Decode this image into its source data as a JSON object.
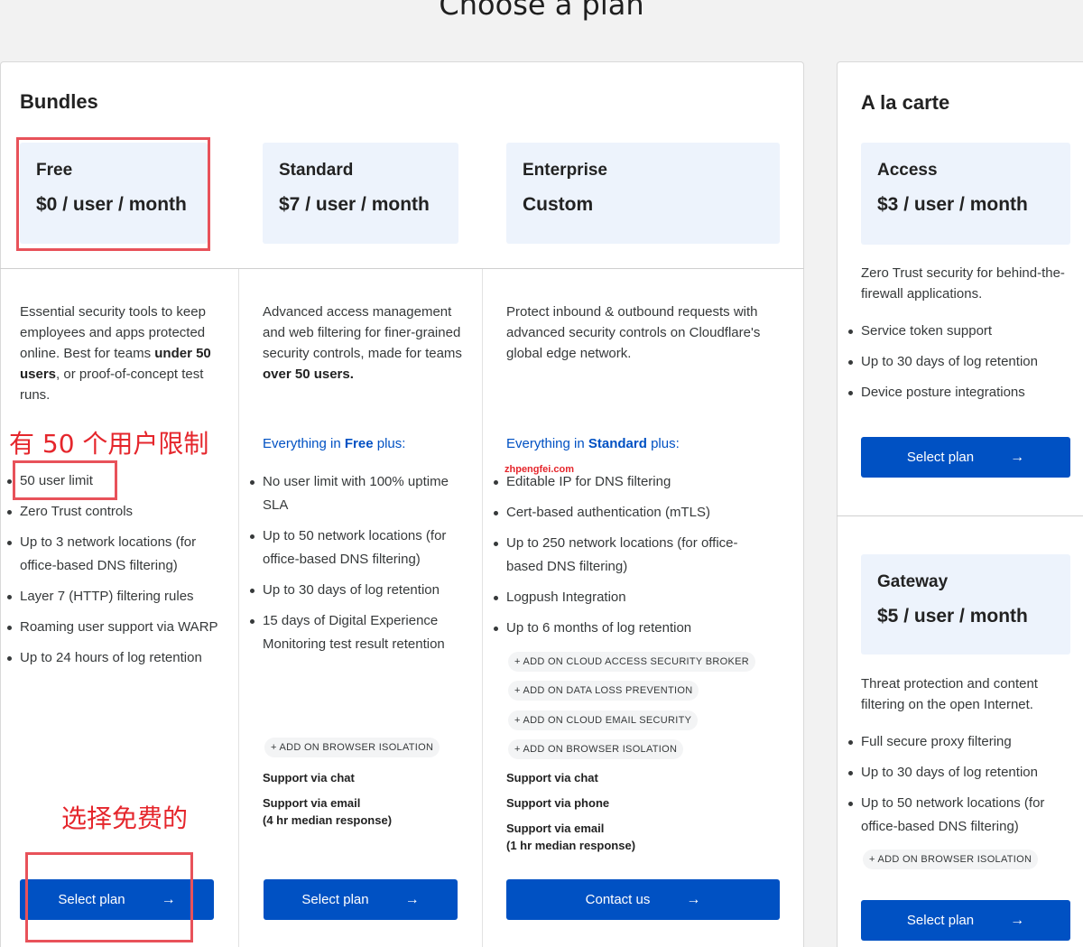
{
  "page": {
    "title": "Choose a plan"
  },
  "bundles": {
    "title": "Bundles",
    "plans": [
      {
        "name": "Free",
        "price": "$0 / user / month",
        "desc_parts": [
          "Essential security tools to keep employees and apps protected online. Best for teams ",
          "under 50 users",
          ", or proof-of-concept test runs."
        ],
        "features": [
          "50 user limit",
          "Zero Trust controls",
          "Up to 3 network locations (for office-based DNS filtering)",
          "Layer 7 (HTTP) filtering rules",
          "Roaming user support via WARP",
          "Up to 24 hours of log retention"
        ],
        "button": "Select plan"
      },
      {
        "name": "Standard",
        "price": "$7 / user / month",
        "desc_parts": [
          "Advanced access management and web filtering for finer-grained security controls, made for teams ",
          "over 50 users."
        ],
        "everything": {
          "prefix": "Everything in ",
          "plan": "Free",
          "suffix": " plus:"
        },
        "features": [
          "No user limit with 100% uptime SLA",
          "Up to 50 network locations (for office-based DNS filtering)",
          "Up to 30 days of log retention",
          "15 days of Digital Experience Monitoring test result retention"
        ],
        "addons": [
          "+ ADD ON BROWSER ISOLATION"
        ],
        "support": [
          "Support via chat",
          "Support via email",
          "(4 hr median response)"
        ],
        "button": "Select plan"
      },
      {
        "name": "Enterprise",
        "price": "Custom",
        "desc": "Protect inbound & outbound requests with advanced security controls on Cloudflare's global edge network.",
        "everything": {
          "prefix": "Everything in ",
          "plan": "Standard",
          "suffix": " plus:"
        },
        "features": [
          "Editable IP for DNS filtering",
          "Cert-based authentication (mTLS)",
          "Up to 250 network locations (for office-based DNS filtering)",
          "Logpush Integration",
          "Up to 6 months of log retention"
        ],
        "addons": [
          "+ ADD ON CLOUD ACCESS SECURITY BROKER",
          "+ ADD ON DATA LOSS PREVENTION",
          "+ ADD ON CLOUD EMAIL SECURITY",
          "+ ADD ON BROWSER ISOLATION"
        ],
        "support": [
          "Support via chat",
          "Support via phone",
          "Support via email",
          "(1 hr median response)"
        ],
        "button": "Contact us"
      }
    ]
  },
  "alacarte": {
    "title": "A la carte",
    "plans": [
      {
        "name": "Access",
        "price": "$3 / user / month",
        "desc": "Zero Trust security for behind-the-firewall applications.",
        "features": [
          "Service token support",
          "Up to 30 days of log retention",
          "Device posture integrations"
        ],
        "button": "Select plan"
      },
      {
        "name": "Gateway",
        "price": "$5 / user / month",
        "desc": "Threat protection and content filtering on the open Internet.",
        "features": [
          "Full secure proxy filtering",
          "Up to 30 days of log retention",
          "Up to 50 network locations (for office-based DNS filtering)"
        ],
        "addons": [
          "+ ADD ON BROWSER ISOLATION"
        ],
        "button": "Select plan"
      }
    ]
  },
  "annotations": {
    "user_limit_note": "有 50 个用户限制",
    "select_free_note": "选择免费的",
    "watermark": "zhpengfei.com"
  },
  "icons": {
    "button_arrow": "→"
  },
  "colors": {
    "accent": "#0051c3",
    "card_bg": "#edf3fc",
    "annotation": "#e8525a"
  }
}
